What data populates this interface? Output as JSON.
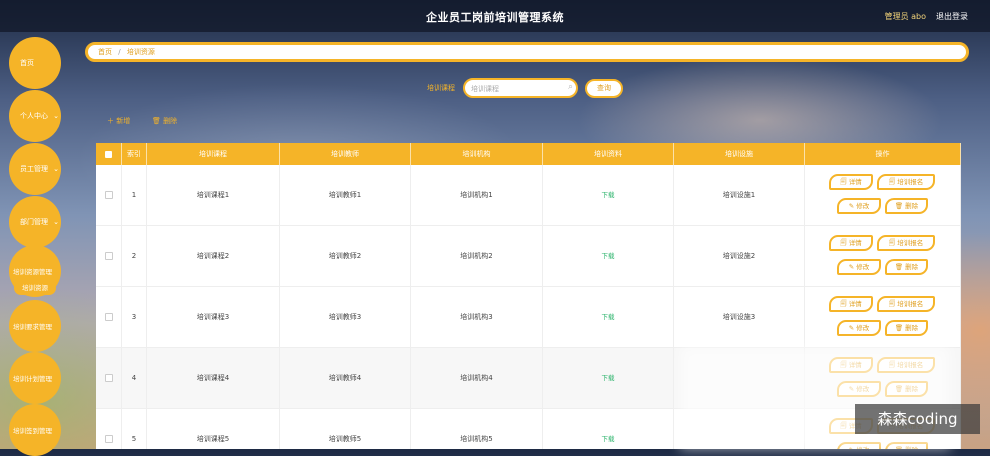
{
  "header": {
    "title": "企业员工岗前培训管理系统",
    "user": "管理员 abo",
    "logout": "退出登录"
  },
  "sidebar": {
    "items": [
      {
        "label": "首页"
      },
      {
        "label": "个人中心"
      },
      {
        "label": "员工管理"
      },
      {
        "label": "部门管理"
      },
      {
        "label": "培训资源管理"
      },
      {
        "label": "培训要求管理"
      },
      {
        "label": "培训计划管理"
      },
      {
        "label": "培训签到管理"
      }
    ],
    "sub_item": "培训资源"
  },
  "breadcrumb": {
    "home": "首页",
    "separator": "/",
    "current": "培训资源"
  },
  "search": {
    "label": "培训课程",
    "placeholder": "培训课程",
    "button": "查询"
  },
  "toolbar": {
    "add": "＋ 新增",
    "delete": "🗑 删除"
  },
  "table": {
    "headers": [
      "索引",
      "培训课程",
      "培训教师",
      "培训机构",
      "培训资料",
      "培训设施",
      "操作"
    ],
    "rows": [
      {
        "index": "1",
        "course": "培训课程1",
        "teacher": "培训教师1",
        "org": "培训机构1",
        "material": "下载",
        "facility": "培训设施1"
      },
      {
        "index": "2",
        "course": "培训课程2",
        "teacher": "培训教师2",
        "org": "培训机构2",
        "material": "下载",
        "facility": "培训设施2"
      },
      {
        "index": "3",
        "course": "培训课程3",
        "teacher": "培训教师3",
        "org": "培训机构3",
        "material": "下载",
        "facility": "培训设施3"
      },
      {
        "index": "4",
        "course": "培训课程4",
        "teacher": "培训教师4",
        "org": "培训机构4",
        "material": "下载",
        "facility": ""
      },
      {
        "index": "5",
        "course": "培训课程5",
        "teacher": "培训教师5",
        "org": "培训机构5",
        "material": "下载",
        "facility": ""
      }
    ],
    "actions": {
      "detail": "🗐 详情",
      "signup": "🗐 培训报名",
      "edit": "✎ 修改",
      "delete": "🗑 删除"
    }
  },
  "watermark": "森森coding",
  "colors": {
    "accent": "#f5b428",
    "download": "#2bb36b",
    "header_bg": "#121828"
  }
}
